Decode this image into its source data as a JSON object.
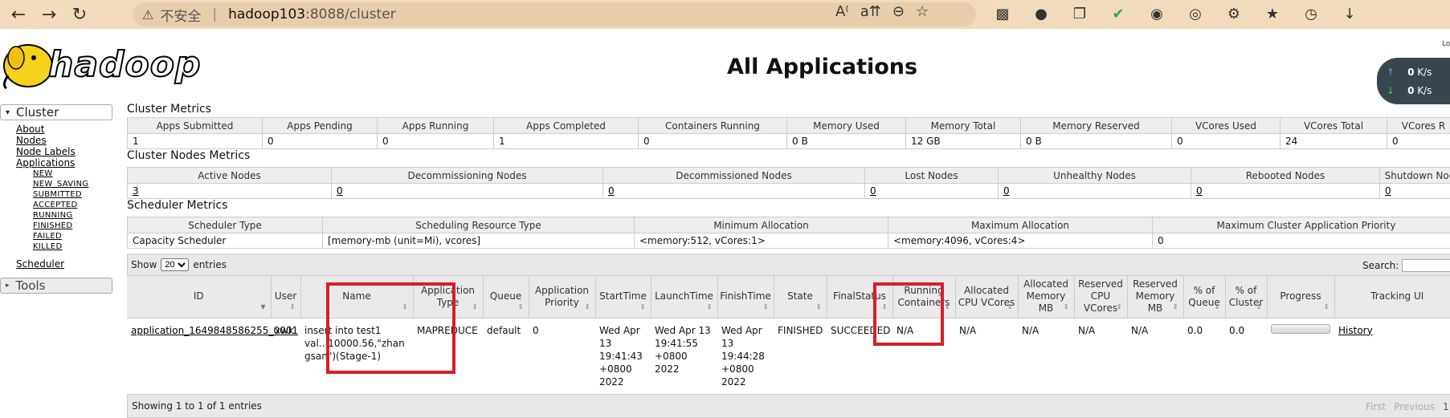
{
  "browser": {
    "insecure_label": "不安全",
    "url_host": "hadoop103",
    "url_path": ":8088/cluster"
  },
  "header": {
    "logo_text": "hadoop",
    "title": "All Applications",
    "net_up": "0",
    "net_down": "0",
    "net_unit": "K/s",
    "net_lo": "Lo"
  },
  "sidebar": {
    "cluster_label": "Cluster",
    "links": [
      "About",
      "Nodes",
      "Node Labels",
      "Applications"
    ],
    "app_states": [
      "NEW",
      "NEW_SAVING",
      "SUBMITTED",
      "ACCEPTED",
      "RUNNING",
      "FINISHED",
      "FAILED",
      "KILLED"
    ],
    "scheduler_label": "Scheduler",
    "tools_label": "Tools"
  },
  "cluster_metrics": {
    "title": "Cluster Metrics",
    "headers": [
      "Apps Submitted",
      "Apps Pending",
      "Apps Running",
      "Apps Completed",
      "Containers Running",
      "Memory Used",
      "Memory Total",
      "Memory Reserved",
      "VCores Used",
      "VCores Total",
      "VCores R"
    ],
    "values": [
      "1",
      "0",
      "0",
      "1",
      "0",
      "0 B",
      "12 GB",
      "0 B",
      "0",
      "24",
      "0"
    ]
  },
  "nodes_metrics": {
    "title": "Cluster Nodes Metrics",
    "headers": [
      "Active Nodes",
      "Decommissioning Nodes",
      "Decommissioned Nodes",
      "Lost Nodes",
      "Unhealthy Nodes",
      "Rebooted Nodes",
      "Shutdown Nod"
    ],
    "values": [
      "3",
      "0",
      "0",
      "0",
      "0",
      "0",
      "0"
    ]
  },
  "scheduler_metrics": {
    "title": "Scheduler Metrics",
    "headers": [
      "Scheduler Type",
      "Scheduling Resource Type",
      "Minimum Allocation",
      "Maximum Allocation",
      "Maximum Cluster Application Priority"
    ],
    "values": [
      "Capacity Scheduler",
      "[memory-mb (unit=Mi), vcores]",
      "<memory:512, vCores:1>",
      "<memory:4096, vCores:4>",
      "0"
    ]
  },
  "datatable": {
    "show_label": "Show",
    "page_size": "20",
    "entries_label": "entries",
    "search_label": "Search:",
    "info": "Showing 1 to 1 of 1 entries",
    "pager": [
      "First",
      "Previous",
      "1"
    ]
  },
  "apps": {
    "headers": [
      "ID",
      "User",
      "Name",
      "Application Type",
      "Queue",
      "Application Priority",
      "StartTime",
      "LaunchTime",
      "FinishTime",
      "State",
      "FinalStatus",
      "Running Containers",
      "Allocated CPU VCores",
      "Allocated Memory MB",
      "Reserved CPU VCores",
      "Reserved Memory MB",
      "% of Queue",
      "% of Cluster",
      "Progress",
      "Tracking UI"
    ],
    "row": {
      "id": "application_1649848586255_0001",
      "user": "xwk",
      "name": "insert into test1 val...10000.56,\"zhangsan\")(Stage-1)",
      "type": "MAPREDUCE",
      "queue": "default",
      "priority": "0",
      "start": "Wed Apr 13 19:41:43 +0800 2022",
      "launch": "Wed Apr 13 19:41:55 +0800 2022",
      "finish": "Wed Apr 13 19:44:28 +0800 2022",
      "state": "FINISHED",
      "final_status": "SUCCEEDED",
      "running_containers": "N/A",
      "alloc_cpu": "N/A",
      "alloc_mem": "N/A",
      "res_cpu": "N/A",
      "res_mem": "N/A",
      "pct_queue": "0.0",
      "pct_cluster": "0.0",
      "progress": 0,
      "tracking": "History"
    }
  },
  "colors": {
    "highlight": "#d4202a",
    "chrome": "#f0dcbc"
  }
}
